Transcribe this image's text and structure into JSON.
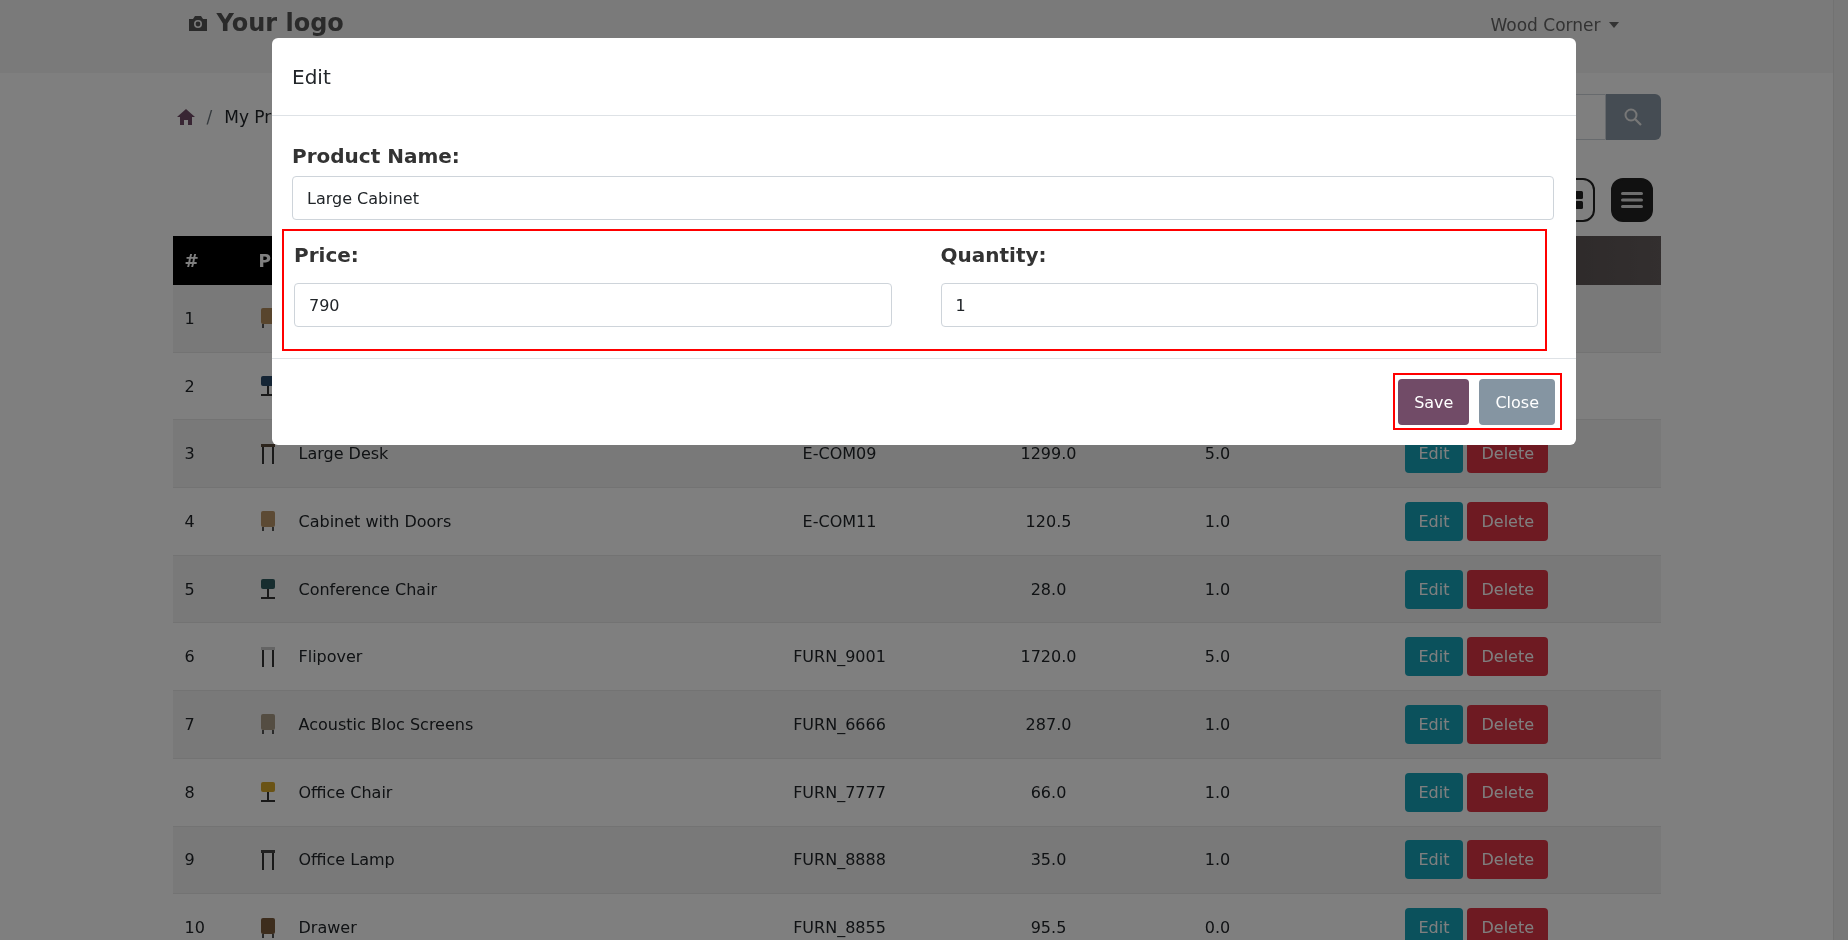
{
  "navbar": {
    "logo": "Your logo",
    "user_menu": "Wood Corner"
  },
  "breadcrumb": {
    "separator": "/",
    "current": "My Pr"
  },
  "table": {
    "columns": [
      "#",
      "P"
    ],
    "rows": [
      {
        "number": "1"
      },
      {
        "number": "2"
      },
      {
        "number": "3",
        "name": "Large Desk",
        "reference": "E-COM09",
        "price": "1299.0",
        "quantity": "5.0",
        "actions": [
          "Edit",
          "Delete"
        ]
      },
      {
        "number": "4",
        "name": "Cabinet with Doors",
        "reference": "E-COM11",
        "price": "120.5",
        "quantity": "1.0",
        "actions": [
          "Edit",
          "Delete"
        ]
      },
      {
        "number": "5",
        "name": "Conference Chair",
        "price": "28.0",
        "quantity": "1.0",
        "actions": [
          "Edit",
          "Delete"
        ]
      },
      {
        "number": "6",
        "name": "Flipover",
        "reference": "FURN_9001",
        "price": "1720.0",
        "quantity": "5.0",
        "actions": [
          "Edit",
          "Delete"
        ]
      },
      {
        "number": "7",
        "name": "Acoustic Bloc Screens",
        "reference": "FURN_6666",
        "price": "287.0",
        "quantity": "1.0",
        "actions": [
          "Edit",
          "Delete"
        ]
      },
      {
        "number": "8",
        "name": "Office Chair",
        "reference": "FURN_7777",
        "price": "66.0",
        "quantity": "1.0",
        "actions": [
          "Edit",
          "Delete"
        ]
      },
      {
        "number": "9",
        "name": "Office Lamp",
        "reference": "FURN_8888",
        "price": "35.0",
        "quantity": "1.0",
        "actions": [
          "Edit",
          "Delete"
        ]
      },
      {
        "number": "10",
        "name": "Drawer",
        "reference": "FURN_8855",
        "price": "95.5",
        "quantity": "0.0",
        "actions": [
          "Edit",
          "Delete"
        ]
      }
    ]
  },
  "modal": {
    "title": "Edit",
    "product_name": {
      "label": "Product Name:",
      "value": "Large Cabinet"
    },
    "price_row": {
      "highlighted": true,
      "fields": [
        {
          "label": "Price:",
          "value": "790"
        },
        {
          "label": "Quantity:",
          "value": "1"
        }
      ]
    },
    "footer": {
      "highlighted": true,
      "buttons": [
        {
          "label": "Save",
          "kind": "primary"
        },
        {
          "label": "Close",
          "kind": "secondary"
        }
      ]
    }
  }
}
